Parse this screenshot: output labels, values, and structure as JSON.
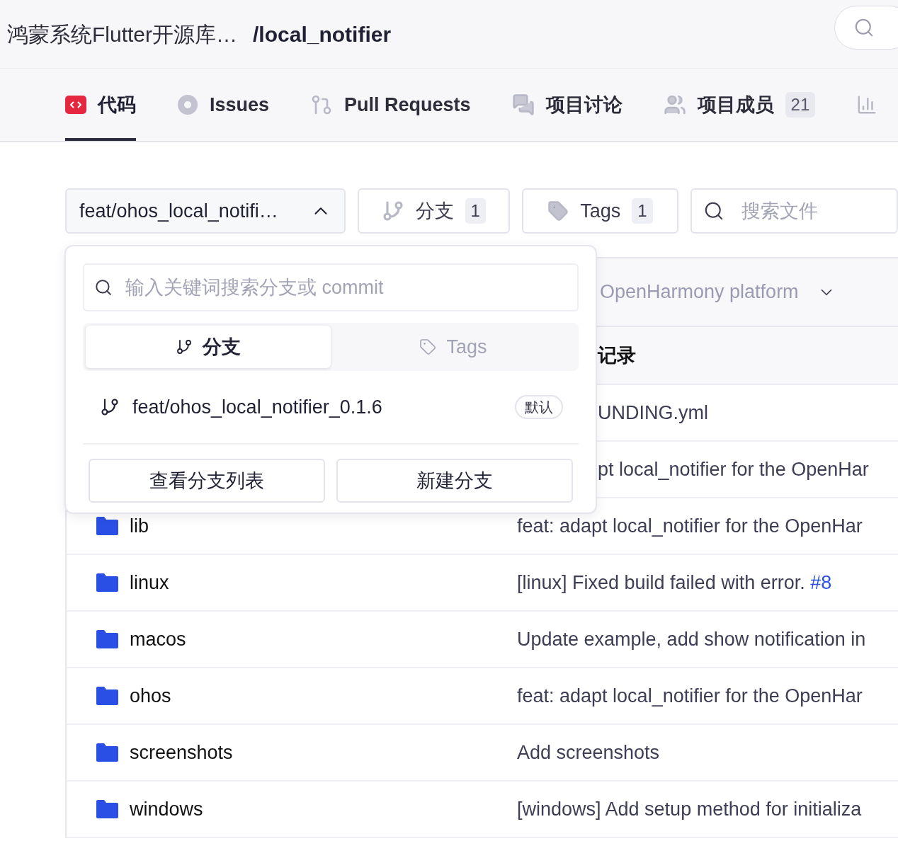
{
  "header": {
    "repo_owner": "鸿蒙系统Flutter开源库…",
    "repo_name": "/local_notifier"
  },
  "tabs": [
    {
      "kind": "code",
      "label": "代码",
      "selected": true
    },
    {
      "kind": "issues",
      "label": "Issues",
      "selected": false
    },
    {
      "kind": "pulls",
      "label": "Pull Requests",
      "selected": false
    },
    {
      "kind": "discuss",
      "label": "项目讨论",
      "selected": false
    },
    {
      "kind": "members",
      "label": "项目成员",
      "count": "21",
      "selected": false
    },
    {
      "kind": "stats",
      "selected": false
    }
  ],
  "toolbar": {
    "branch_select": {
      "value": "feat/ohos_local_notifi…",
      "expanded": true
    },
    "branches": {
      "label": "分支",
      "count": "1"
    },
    "tags": {
      "label": "Tags",
      "count": "1"
    },
    "file_search": {
      "placeholder": "搜索文件"
    }
  },
  "branch_menu": {
    "search": {
      "placeholder": "输入关键词搜索分支或 commit"
    },
    "tabs": [
      {
        "kind": "branch",
        "label": "分支",
        "selected": true
      },
      {
        "kind": "tag",
        "label": "Tags",
        "selected": false
      }
    ],
    "items": [
      {
        "name": "feat/ohos_local_notifier_0.1.6",
        "badge": "默认"
      }
    ],
    "buttons": [
      "查看分支列表",
      "新建分支"
    ]
  },
  "commit_bar": {
    "message": "OpenHarmony platform"
  },
  "table": {
    "header": "记录",
    "rows": [
      {
        "commit": "UNDING.yml"
      },
      {
        "commit": "pt local_notifier for the OpenHar"
      },
      {
        "name": "lib",
        "commit": "feat: adapt local_notifier for the OpenHar"
      },
      {
        "name": "linux",
        "commit": "[linux] Fixed build failed with error.",
        "link": "#8"
      },
      {
        "name": "macos",
        "commit": "Update example, add show notification in"
      },
      {
        "name": "ohos",
        "commit": "feat: adapt local_notifier for the OpenHar"
      },
      {
        "name": "screenshots",
        "commit": "Add screenshots"
      },
      {
        "name": "windows",
        "commit": "[windows] Add setup method for initializa"
      }
    ]
  }
}
